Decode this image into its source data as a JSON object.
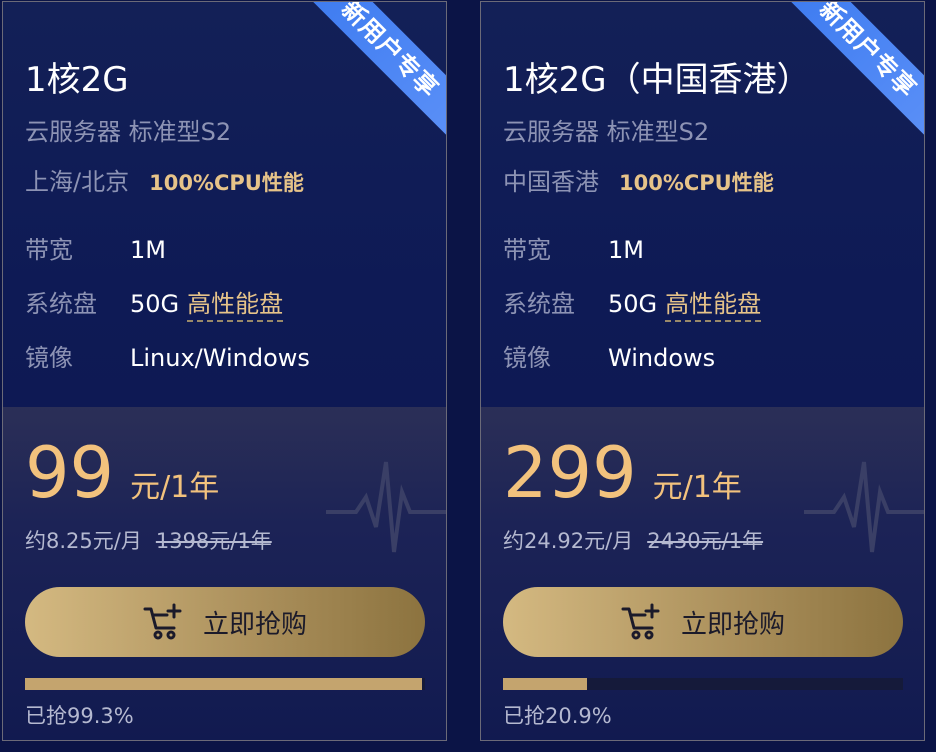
{
  "cards": [
    {
      "ribbon": "新用户专享",
      "title": "1核2G",
      "subtitle": "云服务器 标准型S2",
      "region": "上海/北京",
      "cpu": "100%CPU性能",
      "bandwidth_key": "带宽",
      "bandwidth": "1M",
      "disk_key": "系统盘",
      "disk_size": "50G",
      "disk_type": "高性能盘",
      "image_key": "镜像",
      "image": "Linux/Windows",
      "price": "99",
      "price_unit": "元/1年",
      "monthly": "约8.25元/月",
      "original": "1398元/1年",
      "buy_label": "立即抢购",
      "progress": 99.3,
      "progress_label": "已抢99.3%"
    },
    {
      "ribbon": "新用户专享",
      "title": "1核2G（中国香港）",
      "subtitle": "云服务器 标准型S2",
      "region": "中国香港",
      "cpu": "100%CPU性能",
      "bandwidth_key": "带宽",
      "bandwidth": "1M",
      "disk_key": "系统盘",
      "disk_size": "50G",
      "disk_type": "高性能盘",
      "image_key": "镜像",
      "image": "Windows",
      "price": "299",
      "price_unit": "元/1年",
      "monthly": "约24.92元/月",
      "original": "2430元/1年",
      "buy_label": "立即抢购",
      "progress": 20.9,
      "progress_label": "已抢20.9%"
    }
  ],
  "colors": {
    "background": "#0b1446",
    "gold": "#f2c27d",
    "ribbon": "#4a86f4",
    "button": "#c4a46e"
  },
  "icons": {
    "cart": "cart-plus-icon",
    "decoration": "heartbeat-line-icon"
  }
}
